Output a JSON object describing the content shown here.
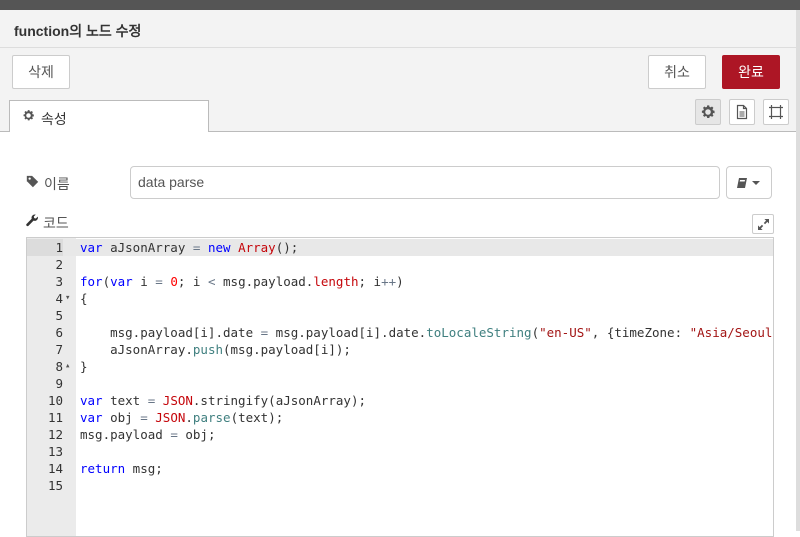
{
  "header": {
    "title": "function의 노드 수정"
  },
  "actions": {
    "delete": "삭제",
    "cancel": "취소",
    "done": "완료"
  },
  "tabs": {
    "properties": "속성"
  },
  "form": {
    "name_label": "이름",
    "name_value": "data parse",
    "code_label": "코드"
  },
  "editor": {
    "line_numbers": [
      "1",
      "2",
      "3",
      "4",
      "5",
      "6",
      "7",
      "8",
      "9",
      "10",
      "11",
      "12",
      "13",
      "14",
      "15"
    ],
    "fold_markers": {
      "4": "▾",
      "8": "▴"
    }
  },
  "colors": {
    "done_button": "#ad1625",
    "header_bg": "#f3f3f3"
  },
  "icons": [
    "gear-icon",
    "document-icon",
    "node-frame-icon",
    "tag-icon",
    "wrench-icon",
    "book-icon",
    "expand-icon",
    "caret-down-icon"
  ]
}
